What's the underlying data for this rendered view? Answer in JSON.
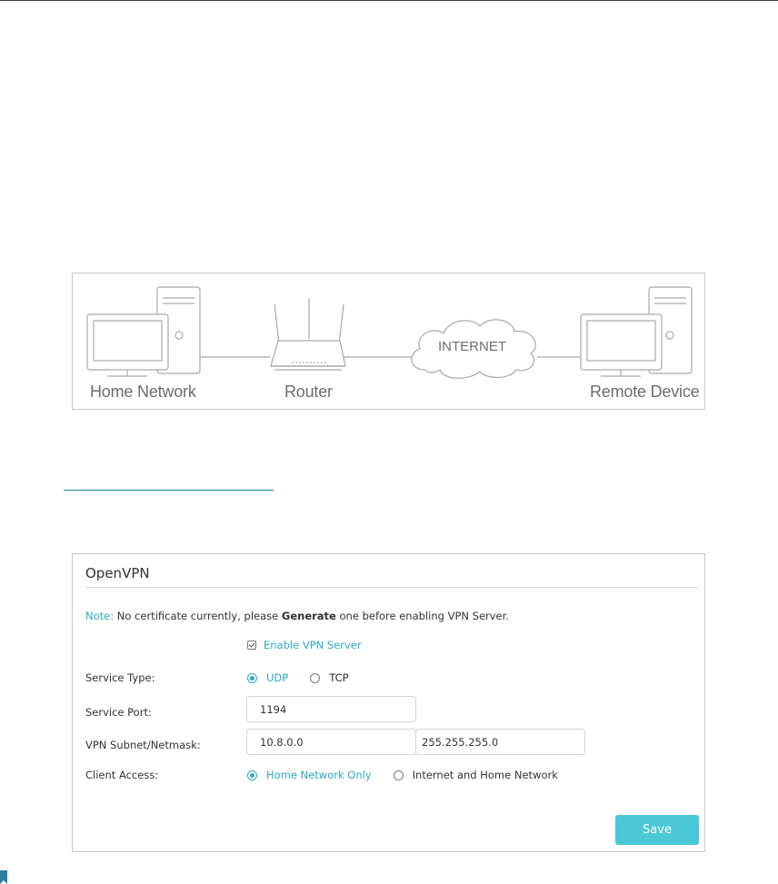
{
  "diagram": {
    "labels": {
      "home_network": "Home Network",
      "router": "Router",
      "internet": "INTERNET",
      "remote_device": "Remote Device"
    }
  },
  "panel": {
    "title": "OpenVPN",
    "note": {
      "label": "Note:",
      "text_before": " No certificate currently, please ",
      "bold": "Generate",
      "text_after": " one before enabling VPN Server."
    },
    "enable_label": "Enable VPN Server",
    "enable_checked": true,
    "service_type": {
      "label": "Service Type:",
      "options": [
        "UDP",
        "TCP"
      ],
      "selected": "UDP"
    },
    "service_port": {
      "label": "Service Port:",
      "value": "1194"
    },
    "subnet": {
      "label": "VPN Subnet/Netmask:",
      "subnet_value": "10.8.0.0",
      "netmask_value": "255.255.255.0"
    },
    "client_access": {
      "label": "Client Access:",
      "options": [
        "Home Network Only",
        "Internet and Home Network"
      ],
      "selected": "Home Network Only"
    },
    "save_label": "Save"
  },
  "colors": {
    "accent": "#2da8c4",
    "button": "#4bc7d6",
    "link": "#1a7fa8",
    "diagram_stroke": "#a9a9a9"
  }
}
